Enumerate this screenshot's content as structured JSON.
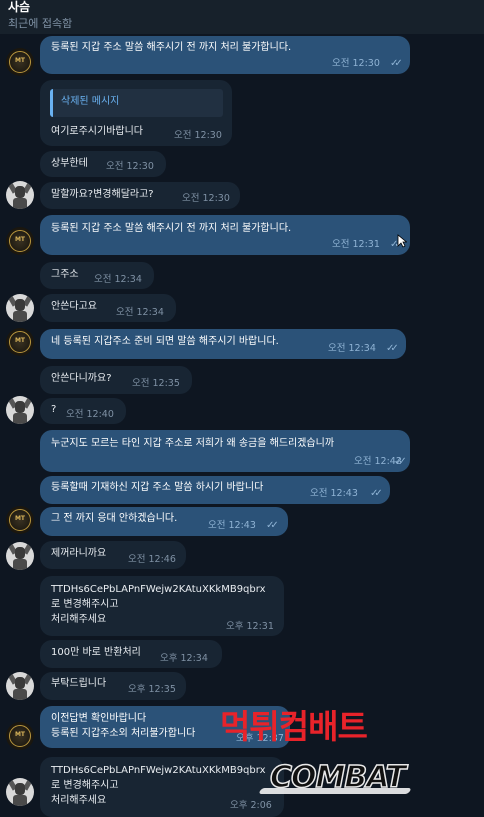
{
  "header": {
    "title": "사슴",
    "status": "최근에 접속함"
  },
  "messages": [
    {
      "id": "m1",
      "text": "등록된 지갑 주소 말씀 해주시기 전 까지 처리 불가합니다.",
      "time": "오전 12:30"
    },
    {
      "id": "m2",
      "quote": "삭제된 메시지",
      "text": "여기로주시기바랍니다",
      "time": "오전 12:30"
    },
    {
      "id": "m3",
      "text": "상부한테",
      "time": "오전 12:30"
    },
    {
      "id": "m4",
      "text": "말할까요?변경해달라고?",
      "time": "오전 12:30"
    },
    {
      "id": "m5",
      "text": "등록된 지갑 주소 말씀 해주시기 전 까지 처리 불가합니다.",
      "time": "오전 12:31"
    },
    {
      "id": "m6",
      "text": "그주소",
      "time": "오전 12:34"
    },
    {
      "id": "m7",
      "text": "안쓴다고요",
      "time": "오전 12:34"
    },
    {
      "id": "m8",
      "text": "네 등록된 지갑주소 준비 되면 말씀 해주시기 바랍니다.",
      "time": "오전 12:34"
    },
    {
      "id": "m9",
      "text": "안쓴다니까요?",
      "time": "오전 12:35"
    },
    {
      "id": "m10",
      "text": "?",
      "time": "오전 12:40"
    },
    {
      "id": "m11",
      "text": "누군지도 모르는 타인 지갑 주소로 저희가 왜 송금을 해드리겠습니까",
      "time": "오전 12:42"
    },
    {
      "id": "m12",
      "text": "등록할때 기재하신 지갑 주소 말씀 하시기 바랍니다",
      "time": "오전 12:43"
    },
    {
      "id": "m13",
      "text": "그 전 까지 응대 안하겠습니다.",
      "time": "오전 12:43"
    },
    {
      "id": "m14",
      "text": "제꺼라니까요",
      "time": "오전 12:46"
    },
    {
      "id": "m15",
      "lines": [
        "TTDHs6CePbLAPnFWejw2KAtuXKkMB9qbrx",
        "로 변경해주시고",
        "처리해주세요"
      ],
      "time": "오후 12:31"
    },
    {
      "id": "m16",
      "text": "100만 바로 반환처리",
      "time": "오후 12:34"
    },
    {
      "id": "m17",
      "text": "부탁드립니다",
      "time": "오후 12:35"
    },
    {
      "id": "m18",
      "lines": [
        "이전답변 확인바랍니다",
        "등록된 지갑주소외 처리불가합니다"
      ],
      "time": "오후 12:37"
    },
    {
      "id": "m19",
      "lines": [
        "TTDHs6CePbLAPnFWejw2KAtuXKkMB9qbrx",
        "로 변경해주시고",
        "처리해주세요"
      ],
      "time": "오후 2:06"
    }
  ],
  "avatars": {
    "admin": "logo-icon",
    "user": "user-avatar-icon"
  },
  "watermark": {
    "korean": "먹튀컴배트",
    "english": "COMBAT"
  },
  "colors": {
    "background": "#0e1621",
    "incoming": "#182533",
    "outgoing": "#2b5278",
    "accent": "#6ab2f2",
    "watermark_red": "#e8232a"
  }
}
